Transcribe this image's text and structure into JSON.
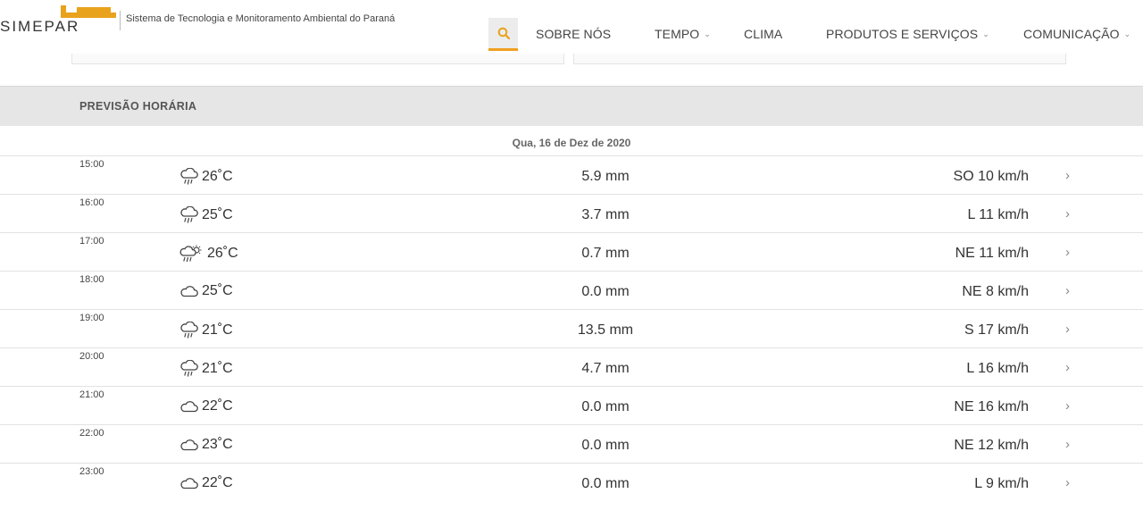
{
  "brand": {
    "logo_text": "SIMEPAR",
    "tagline": "Sistema de Tecnologia e Monitoramento Ambiental do Paraná",
    "accent_color": "#e8a21c"
  },
  "nav": {
    "search_icon": "search-icon",
    "items": [
      {
        "label": "SOBRE NÓS",
        "has_dropdown": false
      },
      {
        "label": "TEMPO",
        "has_dropdown": true
      },
      {
        "label": "CLIMA",
        "has_dropdown": false
      },
      {
        "label": "PRODUTOS E SERVIÇOS",
        "has_dropdown": true
      },
      {
        "label": "COMUNICAÇÃO",
        "has_dropdown": true
      }
    ]
  },
  "forecast": {
    "section_title": "PREVISÃO HORÁRIA",
    "date": "Qua, 16 de Dez de 2020",
    "rows": [
      {
        "time": "15:00",
        "icon": "rain-cloud-icon",
        "temp": "26˚C",
        "rain": "5.9 mm",
        "wind": "SO 10 km/h"
      },
      {
        "time": "16:00",
        "icon": "rain-cloud-icon",
        "temp": "25˚C",
        "rain": "3.7 mm",
        "wind": "L 11 km/h"
      },
      {
        "time": "17:00",
        "icon": "sun-rain-cloud-icon",
        "temp": "26˚C",
        "rain": "0.7 mm",
        "wind": "NE 11 km/h"
      },
      {
        "time": "18:00",
        "icon": "cloud-icon",
        "temp": "25˚C",
        "rain": "0.0 mm",
        "wind": "NE 8 km/h"
      },
      {
        "time": "19:00",
        "icon": "rain-cloud-icon",
        "temp": "21˚C",
        "rain": "13.5 mm",
        "wind": "S 17 km/h"
      },
      {
        "time": "20:00",
        "icon": "rain-cloud-icon",
        "temp": "21˚C",
        "rain": "4.7 mm",
        "wind": "L 16 km/h"
      },
      {
        "time": "21:00",
        "icon": "cloud-icon",
        "temp": "22˚C",
        "rain": "0.0 mm",
        "wind": "NE 16 km/h"
      },
      {
        "time": "22:00",
        "icon": "cloud-icon",
        "temp": "23˚C",
        "rain": "0.0 mm",
        "wind": "NE 12 km/h"
      },
      {
        "time": "23:00",
        "icon": "cloud-icon",
        "temp": "22˚C",
        "rain": "0.0 mm",
        "wind": "L 9 km/h"
      }
    ]
  }
}
